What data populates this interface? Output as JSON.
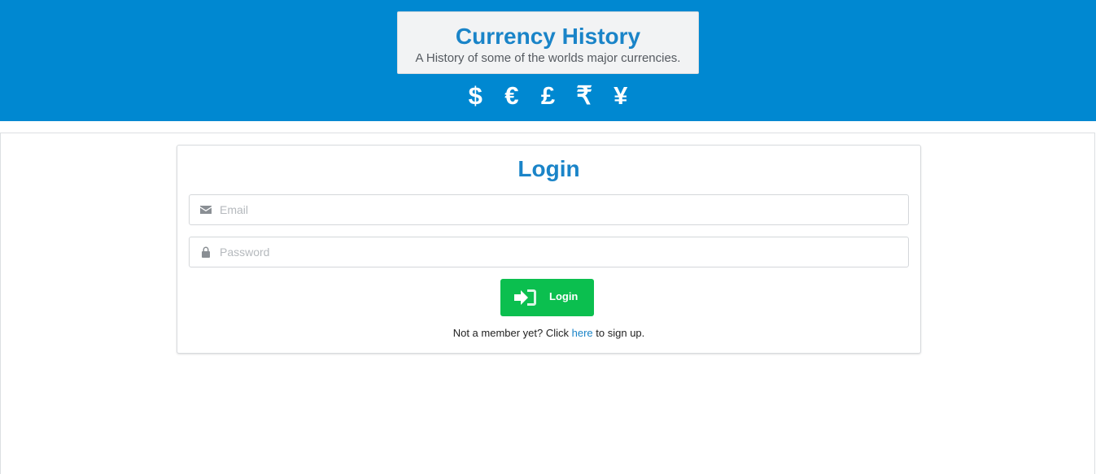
{
  "header": {
    "title": "Currency History",
    "subtitle": "A History of some of the worlds major currencies.",
    "symbols": [
      "$",
      "€",
      "£",
      "₹",
      "¥"
    ],
    "background_color": "#0088d1"
  },
  "login": {
    "heading": "Login",
    "email_placeholder": "Email",
    "password_placeholder": "Password",
    "email_value": "",
    "password_value": "",
    "button_label": "Login",
    "signup_prefix": "Not a member yet? Click ",
    "signup_link": "here",
    "signup_suffix": " to sign up.",
    "button_color": "#0bbf4f",
    "accent_color": "#1a84c8"
  },
  "icons": {
    "email": "envelope-icon",
    "password": "lock-icon",
    "login_button": "sign-in-icon"
  }
}
